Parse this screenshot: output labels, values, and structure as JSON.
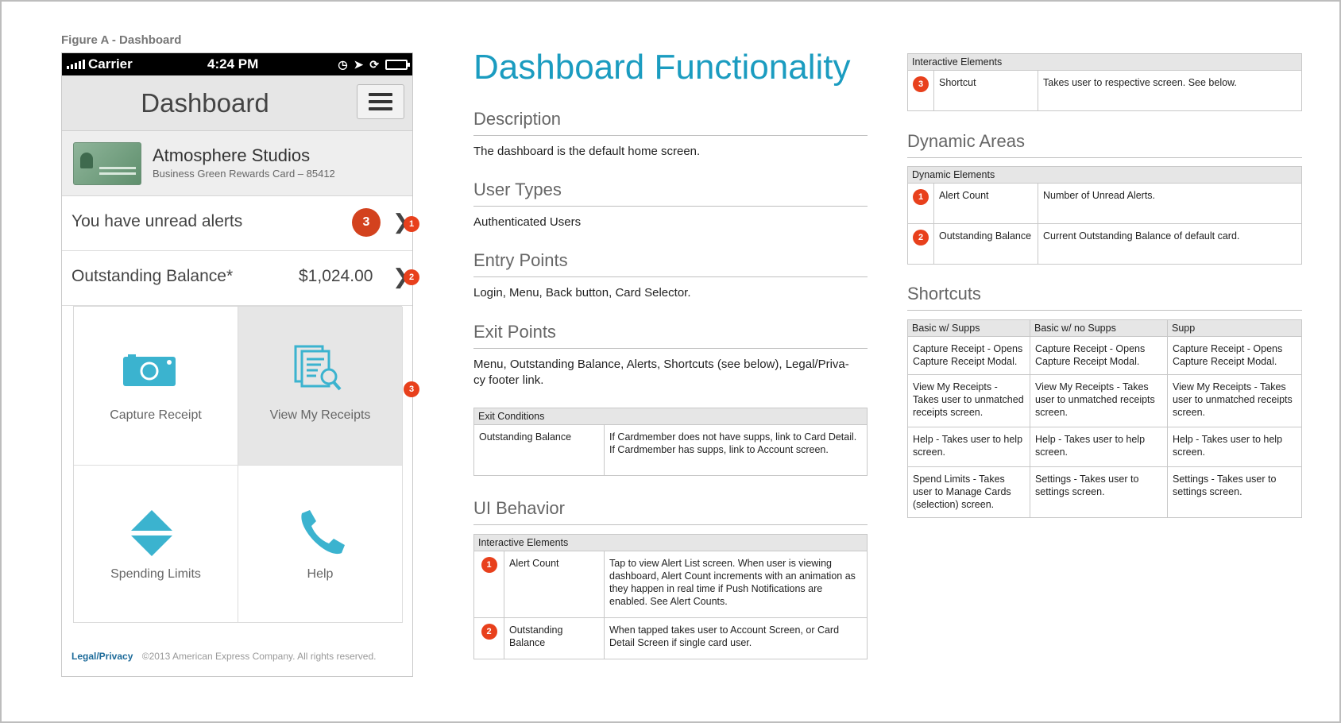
{
  "figure_caption": "Figure A - Dashboard",
  "phone": {
    "status": {
      "carrier": "Carrier",
      "time": "4:24 PM"
    },
    "header_title": "Dashboard",
    "card": {
      "name": "Atmosphere Studios",
      "sub": "Business Green Rewards Card – 85412"
    },
    "alerts": {
      "label": "You have unread alerts",
      "count": "3",
      "annotation": "1"
    },
    "balance": {
      "label": "Outstanding Balance*",
      "amount": "$1,024.00",
      "annotation": "2"
    },
    "grid_annotation": "3",
    "tiles": {
      "capture": "Capture Receipt",
      "view": "View My Receipts",
      "spending": "Spending Limits",
      "help": "Help"
    },
    "footer": {
      "link": "Legal/Privacy",
      "copyright": "©2013 American Express Company. All rights reserved."
    }
  },
  "doc": {
    "title": "Dashboard Functionality",
    "description": {
      "heading": "Description",
      "text": "The dashboard is the default home screen."
    },
    "user_types": {
      "heading": "User Types",
      "text": "Authenticated Users"
    },
    "entry_points": {
      "heading": "Entry Points",
      "text": "Login, Menu, Back button, Card Selector."
    },
    "exit_points": {
      "heading": "Exit Points",
      "text_line1": "Menu, Outstanding Balance, Alerts, Shortcuts (see below), Legal/Priva-",
      "text_line2": "cy footer link."
    },
    "exit_conditions": {
      "header": "Exit Conditions",
      "rows": [
        {
          "name": "Outstanding Balance",
          "desc": "If Cardmember does not have supps, link to Card Detail. If Cardmember has supps, link to Account screen."
        }
      ]
    },
    "ui_behavior": {
      "heading": "UI Behavior",
      "header": "Interactive Elements",
      "rows": [
        {
          "num": "1",
          "name": "Alert Count",
          "desc": "Tap to view Alert List screen. When user is viewing dashboard, Alert Count increments with an animation as they happen in real time if Push Notifications are enabled. See Alert Counts."
        },
        {
          "num": "2",
          "name": "Outstanding Balance",
          "desc": "When tapped takes user to Account Screen, or Card Detail Screen if single card user."
        }
      ]
    },
    "interactive_top": {
      "header": "Interactive Elements",
      "rows": [
        {
          "num": "3",
          "name": "Shortcut",
          "desc": "Takes user to respective screen. See below."
        }
      ]
    },
    "dynamic_areas": {
      "heading": "Dynamic Areas",
      "header": "Dynamic Elements",
      "rows": [
        {
          "num": "1",
          "name": "Alert Count",
          "desc": "Number of Unread Alerts."
        },
        {
          "num": "2",
          "name": "Outstanding Balance",
          "desc": "Current Outstanding Balance of default card."
        }
      ]
    },
    "shortcuts": {
      "heading": "Shortcuts",
      "columns": [
        "Basic w/ Supps",
        "Basic w/ no Supps",
        "Supp"
      ],
      "rows": [
        [
          "Capture Receipt - Opens Capture Receipt Modal.",
          "Capture Receipt - Opens Capture Receipt Modal.",
          "Capture Receipt - Opens Capture Receipt Modal."
        ],
        [
          "View My Receipts - Takes user to unmatched receipts screen.",
          "View My Receipts - Takes user to unmatched receipts screen.",
          "View My Receipts - Takes user to unmatched receipts screen."
        ],
        [
          "Help - Takes user to help screen.",
          "Help - Takes user to help screen.",
          "Help - Takes user to help screen."
        ],
        [
          "Spend Limits - Takes user to Manage Cards (selection) screen.",
          "Settings - Takes user to settings screen.",
          "Settings - Takes user to settings screen."
        ]
      ]
    }
  },
  "colors": {
    "accent": "#1b9cc0",
    "icon": "#3bb3cf",
    "badge": "#d3421e",
    "annotation": "#e8401c"
  }
}
